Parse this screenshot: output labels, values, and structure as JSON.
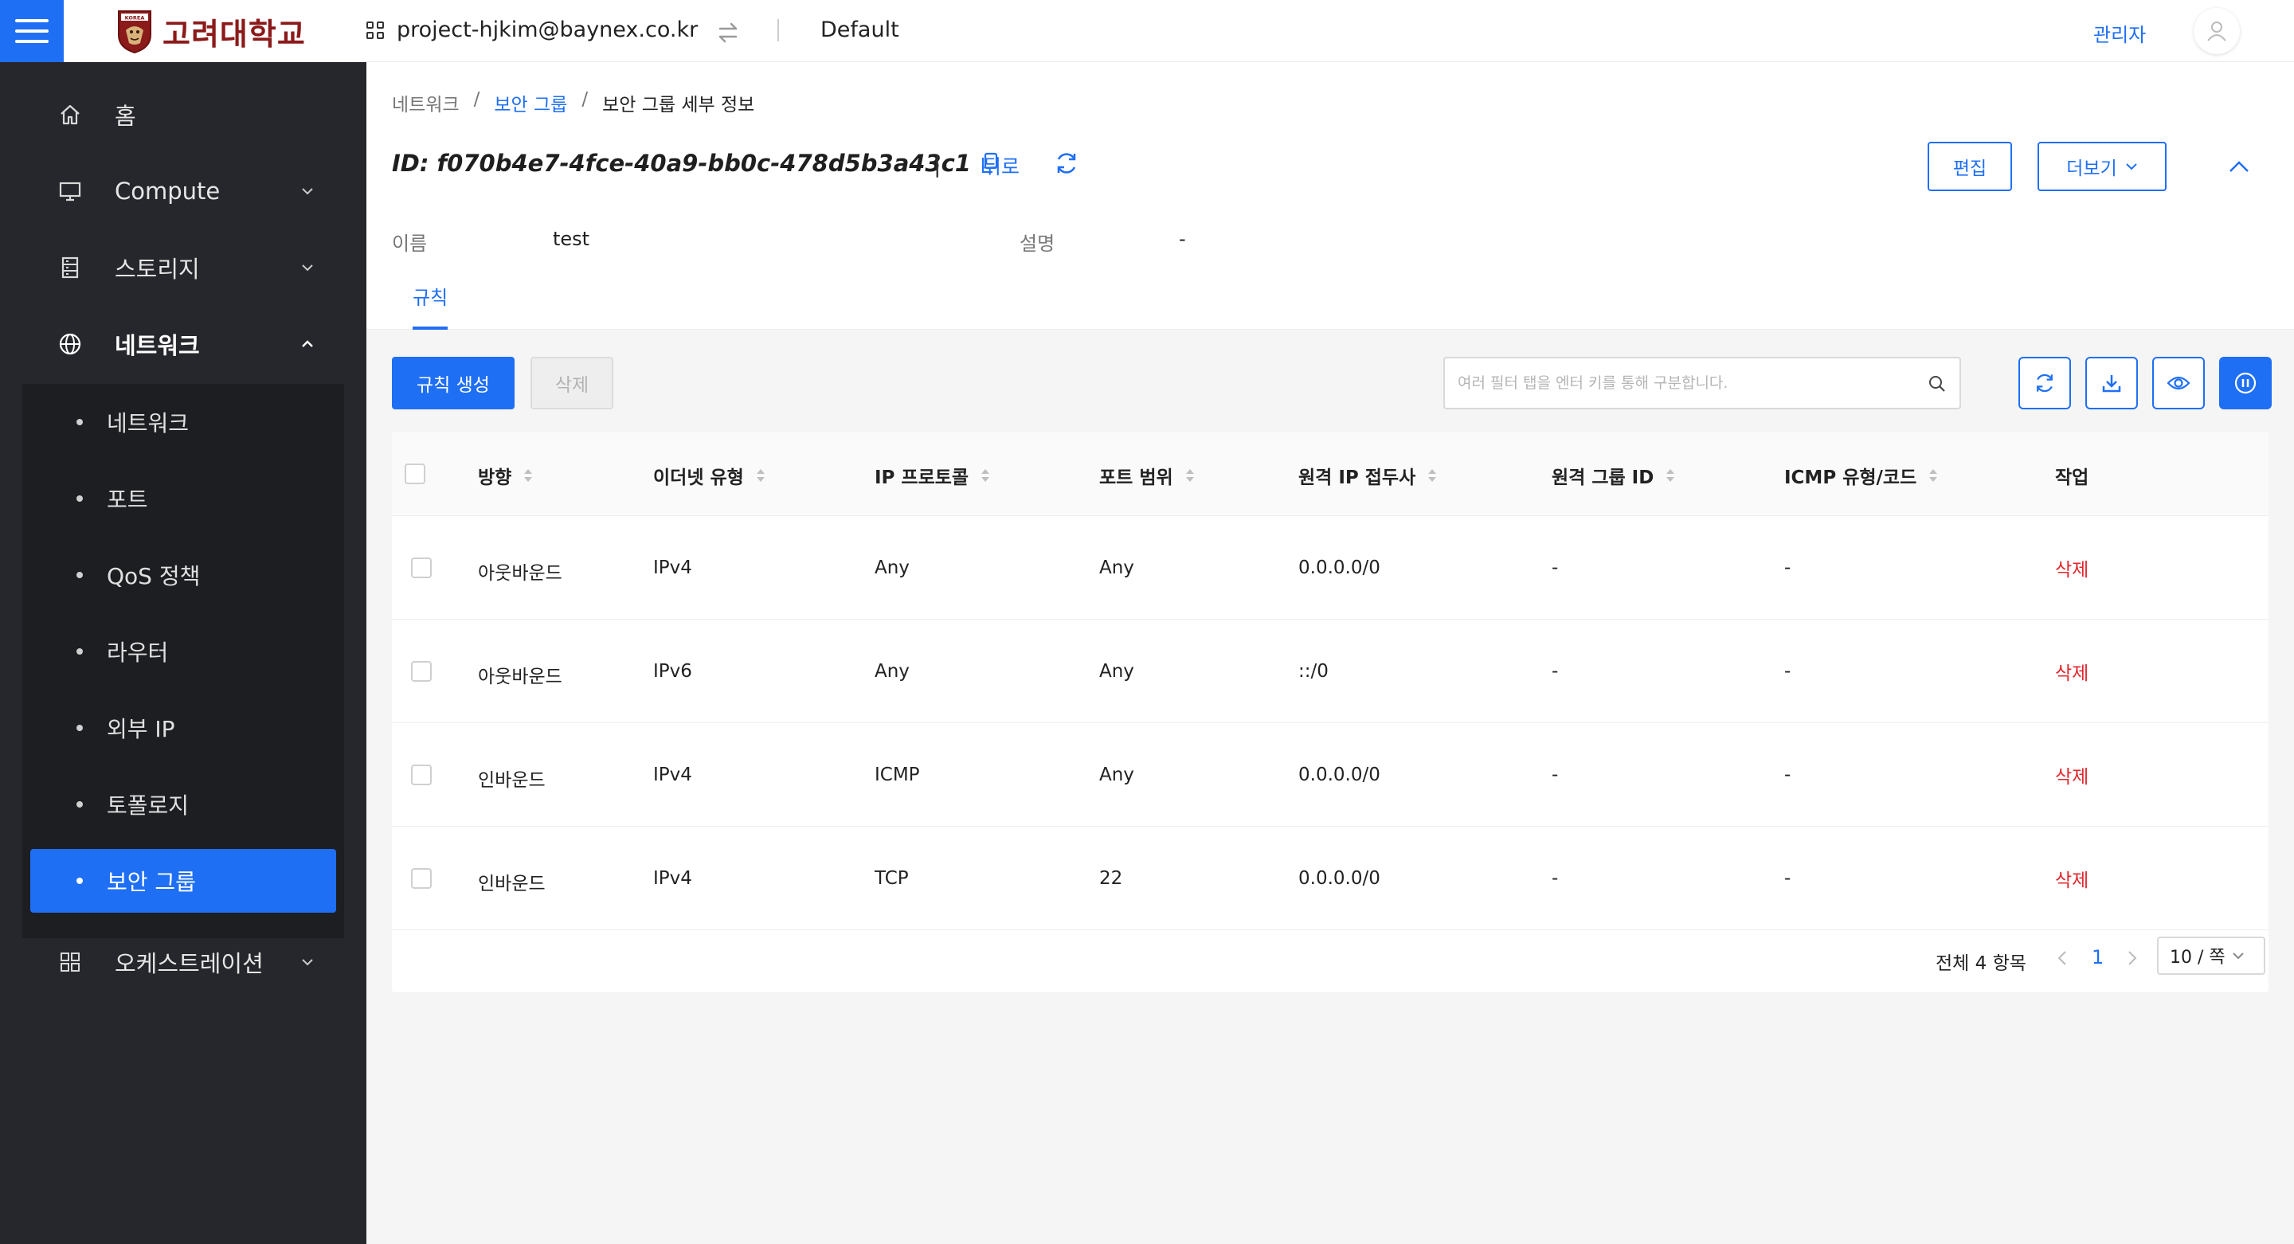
{
  "topbar": {
    "logo_text": "고려대학교",
    "logo_seal_text": "KOREA",
    "project": "project-hjkim@baynex.co.kr",
    "region": "Default",
    "admin_label": "관리자"
  },
  "sidebar": {
    "items": [
      {
        "label": "홈",
        "icon": "home-icon"
      },
      {
        "label": "Compute",
        "icon": "monitor-icon"
      },
      {
        "label": "스토리지",
        "icon": "storage-icon"
      },
      {
        "label": "네트워크",
        "icon": "globe-icon"
      },
      {
        "label": "오케스트레이션",
        "icon": "grid-icon"
      }
    ],
    "network_sub": [
      {
        "label": "네트워크"
      },
      {
        "label": "포트"
      },
      {
        "label": "QoS 정책"
      },
      {
        "label": "라우터"
      },
      {
        "label": "외부 IP"
      },
      {
        "label": "토폴로지"
      },
      {
        "label": "보안 그룹"
      }
    ]
  },
  "breadcrumb": {
    "items": [
      "네트워크",
      "보안 그룹",
      "보안 그룹 세부 정보"
    ],
    "sep": "/"
  },
  "detail": {
    "id_text": "ID:  f070b4e7-4fce-40a9-bb0c-478d5b3a43c1",
    "pipe": "|",
    "back_label": "뒤로",
    "edit_label": "편집",
    "more_label": "더보기",
    "name_key": "이름",
    "name_value": "test",
    "desc_key": "설명",
    "desc_value": "-"
  },
  "tabs": {
    "rules": "규칙"
  },
  "toolbar": {
    "create_label": "규칙 생성",
    "delete_label": "삭제",
    "search_placeholder": "여러 필터 탭을 엔터 키를 통해 구분합니다."
  },
  "table": {
    "headers": [
      "방향",
      "이더넷 유형",
      "IP 프로토콜",
      "포트 범위",
      "원격 IP 접두사",
      "원격 그룹 ID",
      "ICMP 유형/코드",
      "작업"
    ],
    "rows": [
      {
        "direction": "아웃바운드",
        "ether": "IPv4",
        "protocol": "Any",
        "port": "Any",
        "prefix": "0.0.0.0/0",
        "group": "-",
        "icmp": "-",
        "action": "삭제"
      },
      {
        "direction": "아웃바운드",
        "ether": "IPv6",
        "protocol": "Any",
        "port": "Any",
        "prefix": "::/0",
        "group": "-",
        "icmp": "-",
        "action": "삭제"
      },
      {
        "direction": "인바운드",
        "ether": "IPv4",
        "protocol": "ICMP",
        "port": "Any",
        "prefix": "0.0.0.0/0",
        "group": "-",
        "icmp": "-",
        "action": "삭제"
      },
      {
        "direction": "인바운드",
        "ether": "IPv4",
        "protocol": "TCP",
        "port": "22",
        "prefix": "0.0.0.0/0",
        "group": "-",
        "icmp": "-",
        "action": "삭제"
      }
    ]
  },
  "pagination": {
    "total": "전체 4 항목",
    "current_page": "1",
    "page_size": "10 / 쪽"
  },
  "colors": {
    "accent": "#1f6ff5",
    "sidebar_bg": "#26272c",
    "danger": "#e0282e",
    "brand": "#8b1a1a"
  }
}
